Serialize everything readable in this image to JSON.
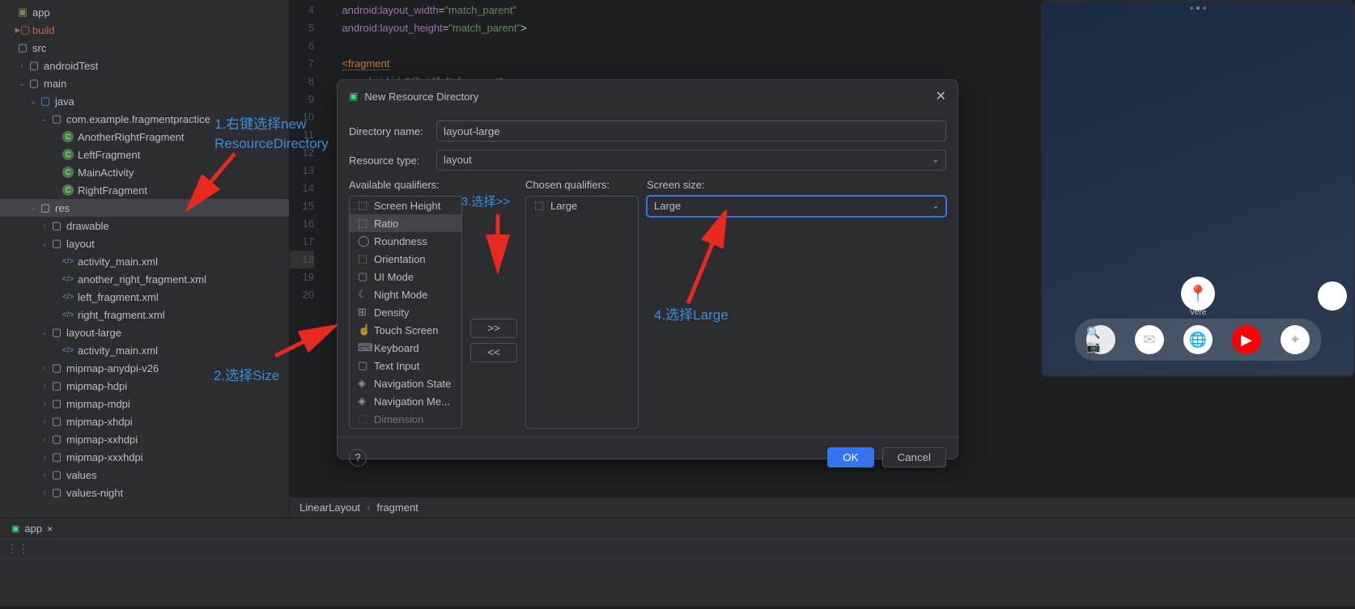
{
  "tree": {
    "app": "app",
    "build": "build",
    "src": "src",
    "androidTest": "androidTest",
    "main": "main",
    "java": "java",
    "package": "com.example.fragmentpractice",
    "classes": [
      "AnotherRightFragment",
      "LeftFragment",
      "MainActivity",
      "RightFragment"
    ],
    "res": "res",
    "drawable": "drawable",
    "layout": "layout",
    "layout_files": [
      "activity_main.xml",
      "another_right_fragment.xml",
      "left_fragment.xml",
      "right_fragment.xml"
    ],
    "layout_large": "layout-large",
    "layout_large_files": [
      "activity_main.xml"
    ],
    "mipmap_folders": [
      "mipmap-anydpi-v26",
      "mipmap-hdpi",
      "mipmap-mdpi",
      "mipmap-xhdpi",
      "mipmap-xxhdpi",
      "mipmap-xxxhdpi"
    ],
    "values": "values",
    "values_night": "values-night"
  },
  "code": {
    "lines": [
      "4",
      "5",
      "6",
      "7",
      "8",
      "9",
      "10",
      "11",
      "12",
      "13",
      "14",
      "15",
      "16",
      "17",
      "18",
      "19",
      "20"
    ],
    "l4_attr": "android:layout_width",
    "l4_val": "\"match_parent\"",
    "l5_attr": "android:layout_height",
    "l5_val": "\"match_parent\"",
    "l5_close": ">",
    "l7_tag": "<fragment",
    "l8_attr": "android:id",
    "l8_val": "\"@+id/left_fragment\""
  },
  "breadcrumb": {
    "item1": "LinearLayout",
    "item2": "fragment"
  },
  "dialog": {
    "title": "New Resource Directory",
    "dir_label": "Directory name:",
    "dir_value": "layout-large",
    "type_label": "Resource type:",
    "type_value": "layout",
    "avail_label": "Available qualifiers:",
    "chosen_label": "Chosen qualifiers:",
    "screen_label": "Screen size:",
    "screen_value": "Large",
    "chosen_item": "Large",
    "avail_items": [
      "Screen Height",
      "Ratio",
      "Roundness",
      "Orientation",
      "UI Mode",
      "Night Mode",
      "Density",
      "Touch Screen",
      "Keyboard",
      "Text Input",
      "Navigation State",
      "Navigation Me...",
      "Dimension"
    ],
    "add_btn": ">>",
    "remove_btn": "<<",
    "ok": "OK",
    "cancel": "Cancel",
    "help": "?"
  },
  "annotations": {
    "a1": "1.右键选择new ResourceDirectory",
    "a2": "2.选择Size",
    "a3": "3.选择>>",
    "a4": "4.选择Large"
  },
  "tabs": {
    "app_tab": "app"
  }
}
